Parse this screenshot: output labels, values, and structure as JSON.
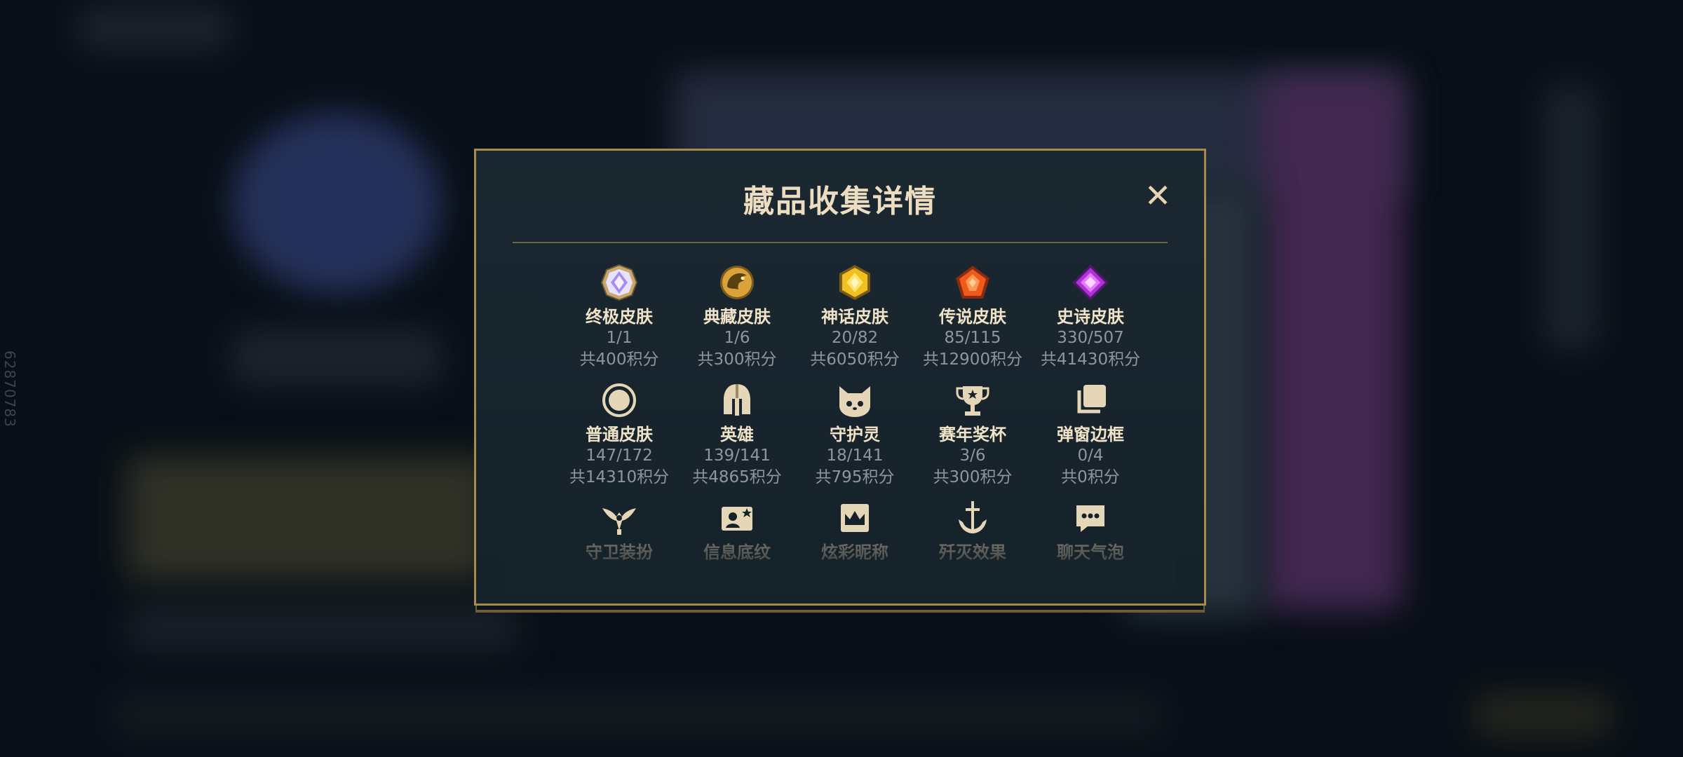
{
  "side_id": "62870783",
  "modal": {
    "title": "藏品收集详情"
  },
  "items": [
    {
      "icon": "ultimate-gem-icon",
      "name": "终极皮肤",
      "count": "1/1",
      "points": "共400积分"
    },
    {
      "icon": "prestige-dragon-icon",
      "name": "典藏皮肤",
      "count": "1/6",
      "points": "共300积分"
    },
    {
      "icon": "mythic-gem-icon",
      "name": "神话皮肤",
      "count": "20/82",
      "points": "共6050积分"
    },
    {
      "icon": "legendary-gem-icon",
      "name": "传说皮肤",
      "count": "85/115",
      "points": "共12900积分"
    },
    {
      "icon": "epic-gem-icon",
      "name": "史诗皮肤",
      "count": "330/507",
      "points": "共41430积分"
    },
    {
      "icon": "standard-skin-icon",
      "name": "普通皮肤",
      "count": "147/172",
      "points": "共14310积分"
    },
    {
      "icon": "helmet-icon",
      "name": "英雄",
      "count": "139/141",
      "points": "共4865积分"
    },
    {
      "icon": "little-legend-icon",
      "name": "守护灵",
      "count": "18/141",
      "points": "共795积分"
    },
    {
      "icon": "trophy-icon",
      "name": "赛年奖杯",
      "count": "3/6",
      "points": "共300积分"
    },
    {
      "icon": "frame-stack-icon",
      "name": "弹窗边框",
      "count": "0/4",
      "points": "共0积分"
    },
    {
      "icon": "ward-icon",
      "name": "守卫装扮"
    },
    {
      "icon": "banner-icon",
      "name": "信息底纹"
    },
    {
      "icon": "crown-nameplate-icon",
      "name": "炫彩昵称"
    },
    {
      "icon": "finisher-anchor-icon",
      "name": "歼灭效果"
    },
    {
      "icon": "chat-bubble-icon",
      "name": "聊天气泡"
    }
  ],
  "colors": {
    "accent_gold": "#a78b4d",
    "title_text": "#ecdcc0",
    "muted_text": "#8f969c"
  }
}
